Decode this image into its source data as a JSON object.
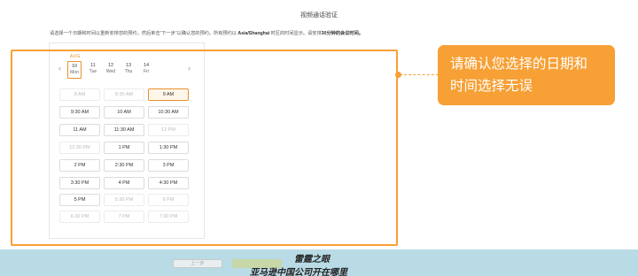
{
  "page": {
    "title": "视频通话验证",
    "instruction_part1": "请选择一个日期和时间以重新安排您的预约。然后单击“下一步”以确认您的预约。所有预约以 ",
    "instruction_tz": "Asia/Shanghai",
    "instruction_part2": " 时区的时间显示。请安排",
    "instruction_bold": "30分钟的会议时间。"
  },
  "calendar": {
    "month": "AUG",
    "prev_icon": "chevron-left-icon",
    "next_icon": "chevron-right-icon",
    "days": [
      {
        "date": "10",
        "dow": "Mon",
        "selected": true
      },
      {
        "date": "11",
        "dow": "Tue",
        "selected": false
      },
      {
        "date": "12",
        "dow": "Wed",
        "selected": false
      },
      {
        "date": "13",
        "dow": "Thu",
        "selected": false
      },
      {
        "date": "14",
        "dow": "Fri",
        "selected": false
      }
    ]
  },
  "slots": [
    {
      "label": "8 AM",
      "state": "disabled"
    },
    {
      "label": "8:30 AM",
      "state": "disabled"
    },
    {
      "label": "9 AM",
      "state": "selected"
    },
    {
      "label": "9:30 AM",
      "state": "available"
    },
    {
      "label": "10 AM",
      "state": "available"
    },
    {
      "label": "10:30 AM",
      "state": "available"
    },
    {
      "label": "11 AM",
      "state": "available"
    },
    {
      "label": "11:30 AM",
      "state": "available"
    },
    {
      "label": "12 PM",
      "state": "disabled"
    },
    {
      "label": "12:30 PM",
      "state": "disabled"
    },
    {
      "label": "1 PM",
      "state": "available"
    },
    {
      "label": "1:30 PM",
      "state": "available"
    },
    {
      "label": "2 PM",
      "state": "available"
    },
    {
      "label": "2:30 PM",
      "state": "available"
    },
    {
      "label": "3 PM",
      "state": "available"
    },
    {
      "label": "3:30 PM",
      "state": "available"
    },
    {
      "label": "4 PM",
      "state": "available"
    },
    {
      "label": "4:30 PM",
      "state": "available"
    },
    {
      "label": "5 PM",
      "state": "available"
    },
    {
      "label": "5:30 PM",
      "state": "disabled"
    },
    {
      "label": "6 PM",
      "state": "disabled"
    },
    {
      "label": "6:30 PM",
      "state": "disabled"
    },
    {
      "label": "7 PM",
      "state": "disabled"
    },
    {
      "label": "7:30 PM",
      "state": "disabled"
    }
  ],
  "callout": {
    "text_line1": "请确认您选择的日期和",
    "text_line2": "时间选择无误"
  },
  "footer": {
    "prev_label": "上一步",
    "watermark_line1": "雷霆之眼",
    "watermark_line2": "亚马逊中国公司开在哪里"
  },
  "colors": {
    "accent": "#f7a035",
    "selected_border": "#e8912d",
    "footer_bg": "#b9dbe6"
  }
}
